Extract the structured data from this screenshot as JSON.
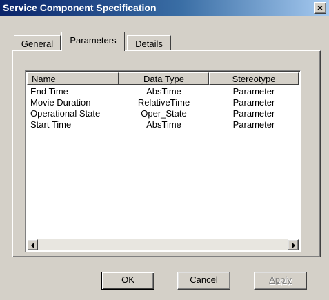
{
  "window": {
    "title": "Service Component Specification",
    "close_label": "×"
  },
  "tabs": [
    {
      "label": "General",
      "selected": false
    },
    {
      "label": "Parameters",
      "selected": true
    },
    {
      "label": "Details",
      "selected": false
    }
  ],
  "list": {
    "columns": [
      "Name",
      "Data Type",
      "Stereotype"
    ],
    "rows": [
      {
        "name": "End Time",
        "data_type": "AbsTime",
        "stereotype": "Parameter"
      },
      {
        "name": "Movie Duration",
        "data_type": "RelativeTime",
        "stereotype": "Parameter"
      },
      {
        "name": "Operational State",
        "data_type": "Oper_State",
        "stereotype": "Parameter"
      },
      {
        "name": "Start Time",
        "data_type": "AbsTime",
        "stereotype": "Parameter"
      }
    ]
  },
  "buttons": {
    "ok": "OK",
    "cancel": "Cancel",
    "apply": "Apply"
  }
}
